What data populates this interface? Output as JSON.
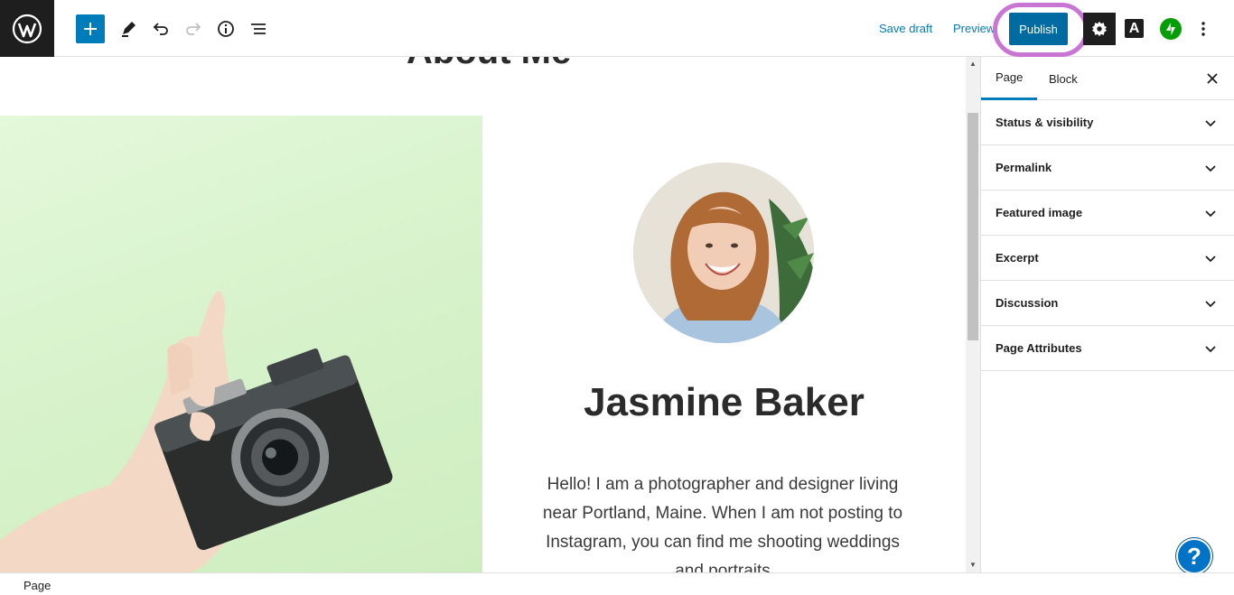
{
  "toolbar": {
    "save_draft": "Save draft",
    "preview": "Preview",
    "publish": "Publish",
    "amp_letter": "A"
  },
  "content": {
    "page_title": "About Me",
    "name": "Jasmine Baker",
    "bio": "Hello! I am a photographer and designer living near Portland, Maine. When I am not posting to Instagram, you can find me shooting weddings and portraits"
  },
  "sidebar": {
    "tabs": [
      {
        "label": "Page",
        "active": true
      },
      {
        "label": "Block",
        "active": false
      }
    ],
    "panels": [
      {
        "label": "Status & visibility"
      },
      {
        "label": "Permalink"
      },
      {
        "label": "Featured image"
      },
      {
        "label": "Excerpt"
      },
      {
        "label": "Discussion"
      },
      {
        "label": "Page Attributes"
      }
    ]
  },
  "help": {
    "label": "?"
  },
  "footer": {
    "breadcrumb": "Page"
  },
  "colors": {
    "accent": "#007cba",
    "publish": "#006ba1",
    "highlight": "#c975d3",
    "jetpack": "#069e08",
    "help": "#0073c6"
  }
}
